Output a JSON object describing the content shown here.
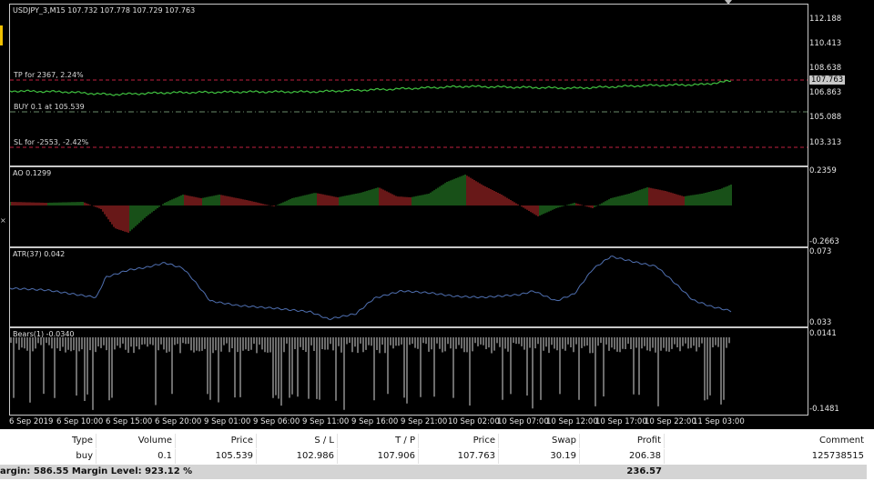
{
  "chart": {
    "title": "USDJPY_3,M15  107.732 107.778 107.729 107.763",
    "levels": {
      "tp_label": "TP for 2367, 2.24%",
      "buy_label": "BUY 0.1 at 105.539",
      "sl_label": "SL for -2553, -2.42%"
    },
    "price_axis": [
      "112.188",
      "110.413",
      "108.638",
      "106.863",
      "105.088",
      "103.313"
    ],
    "current_price": "107.763",
    "ao": {
      "title": "AO 0.1299",
      "axis_top": "0.2359",
      "axis_bottom": "-0.2663"
    },
    "atr": {
      "title": "ATR(37) 0.042",
      "axis_top": "0.073",
      "axis_bottom": "0.033"
    },
    "bears": {
      "title": "Bears(1) -0.0340",
      "axis_top": "0.0141",
      "axis_bottom": "-0.1481"
    },
    "time_axis": [
      "6 Sep 2019",
      "6 Sep 10:00",
      "6 Sep 15:00",
      "6 Sep 20:00",
      "9 Sep 01:00",
      "9 Sep 06:00",
      "9 Sep 11:00",
      "9 Sep 16:00",
      "9 Sep 21:00",
      "10 Sep 02:00",
      "10 Sep 07:00",
      "10 Sep 12:00",
      "10 Sep 17:00",
      "10 Sep 22:00",
      "11 Sep 03:00"
    ],
    "colors": {
      "price_line": "#3fbf3f",
      "tp_line": "#c02040",
      "buy_line": "#6a8a6a",
      "sl_line": "#c02040",
      "ao_up": "#2fa02f",
      "ao_down": "#d03030",
      "atr_line": "#4f6fb0",
      "bears": "#d8d8d8"
    }
  },
  "terminal": {
    "columns": [
      "Type",
      "Volume",
      "Price",
      "S / L",
      "T / P",
      "Price",
      "Swap",
      "Profit",
      "Comment"
    ],
    "rows": [
      [
        "buy",
        "0.1",
        "105.539",
        "102.986",
        "107.906",
        "107.763",
        "30.19",
        "206.38",
        "125738515"
      ]
    ],
    "summary_label": "argin: 586.55  Margin Level: 923.12 %",
    "summary_total": "236.57"
  }
}
